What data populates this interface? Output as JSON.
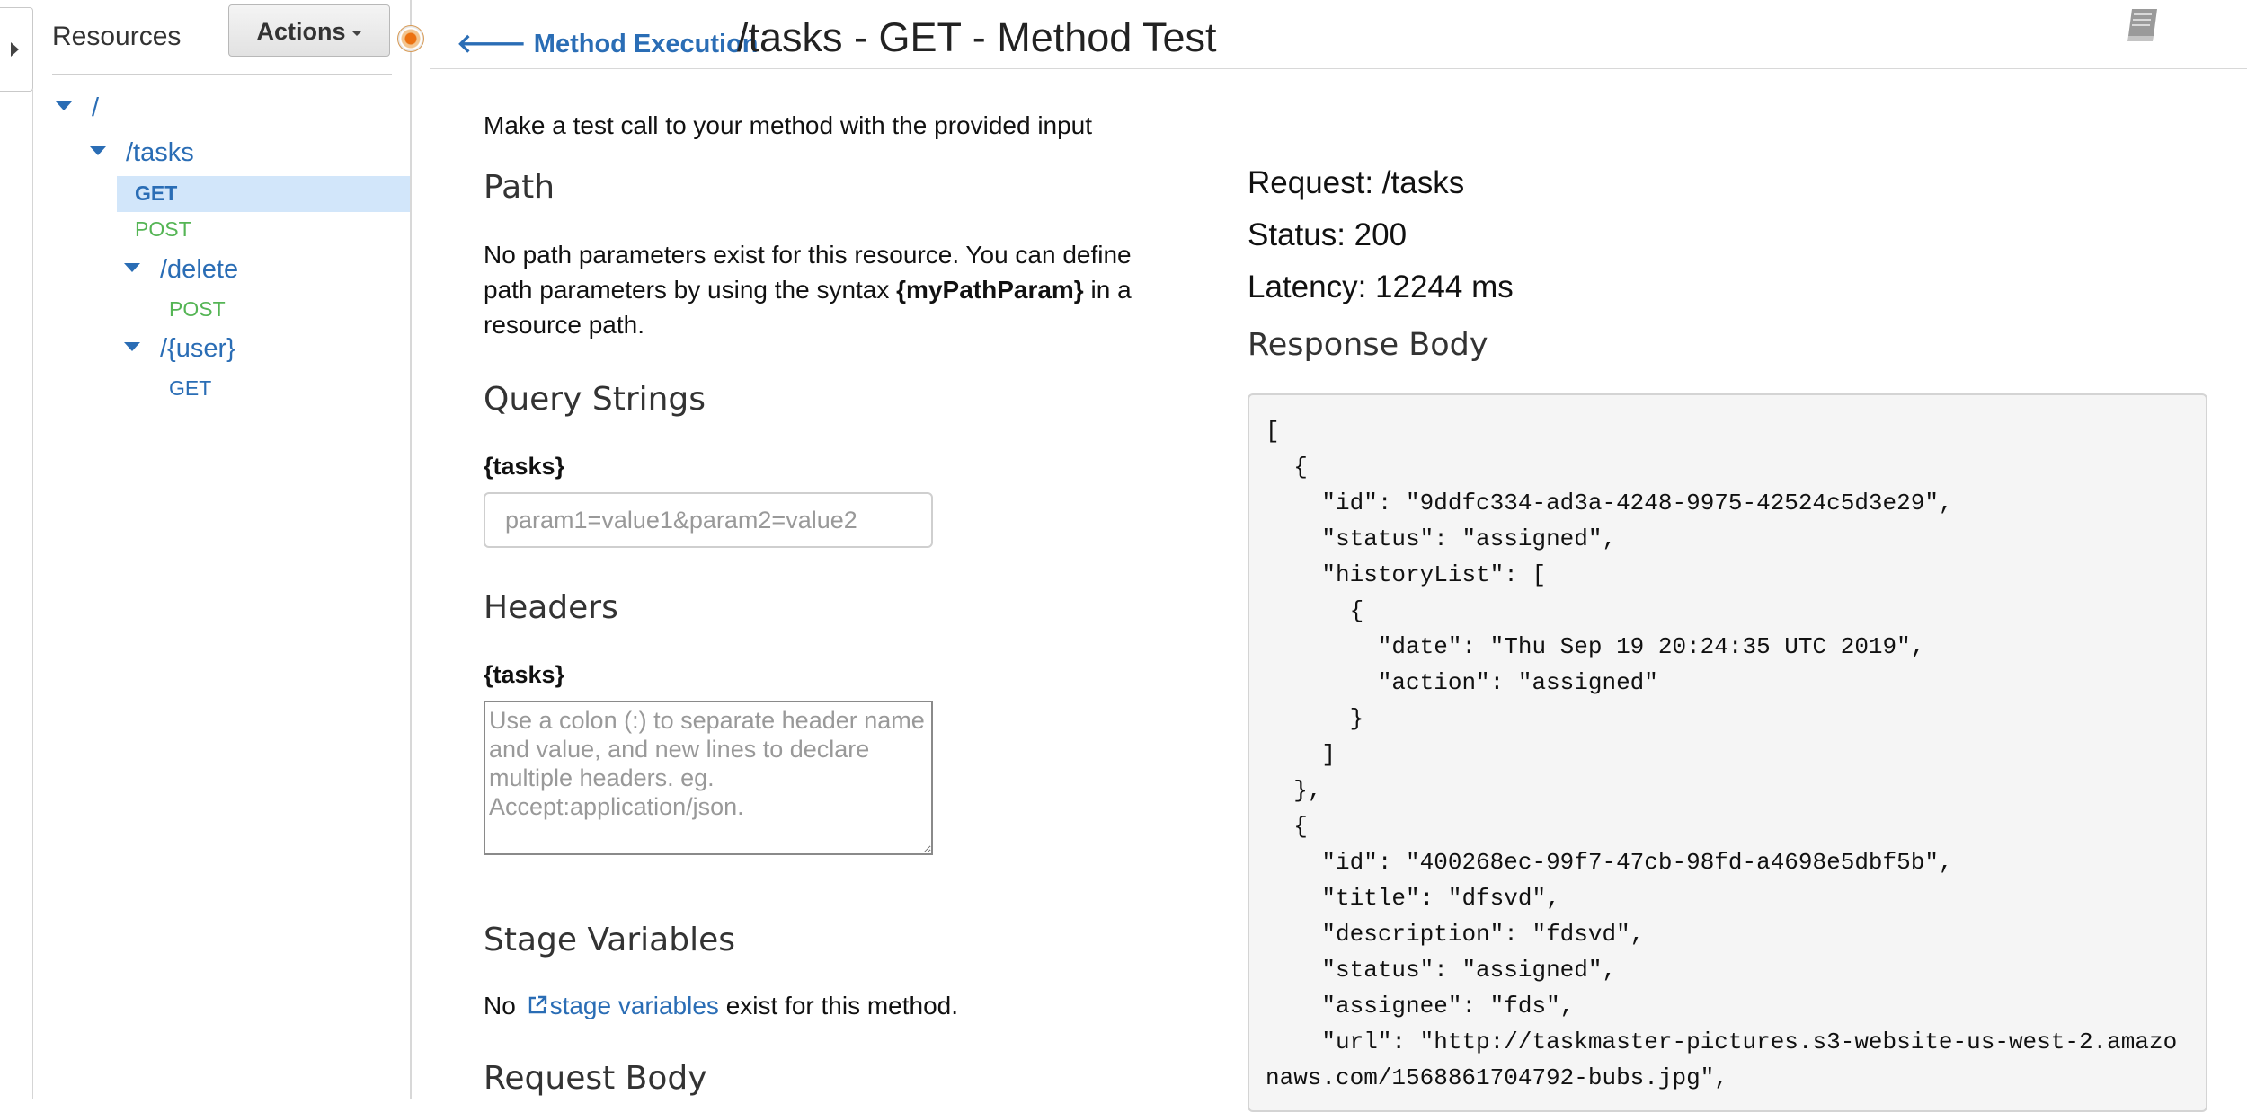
{
  "sidebar": {
    "title": "Resources",
    "actions_label": "Actions",
    "tree": {
      "root": "/",
      "tasks": "/tasks",
      "tasks_get": "GET",
      "tasks_post": "POST",
      "delete": "/delete",
      "delete_post": "POST",
      "user": "/{user}",
      "user_get": "GET"
    }
  },
  "header": {
    "back_label": "Method Execution",
    "title": "/tasks - GET - Method Test"
  },
  "main": {
    "intro": "Make a test call to your method with the provided input",
    "path_heading": "Path",
    "path_text_1": "No path parameters exist for this resource. You can define path parameters by using the syntax ",
    "path_text_bold": "{myPathParam}",
    "path_text_2": " in a resource path.",
    "query_heading": "Query Strings",
    "query_label": "{tasks}",
    "query_placeholder": "param1=value1&param2=value2",
    "headers_heading": "Headers",
    "headers_label": "{tasks}",
    "headers_placeholder": "Use a colon (:) to separate header name and value, and new lines to declare multiple headers. eg. Accept:application/json.",
    "stage_heading": "Stage Variables",
    "stage_pre": "No ",
    "stage_link": "stage variables",
    "stage_post": " exist for this method.",
    "request_body_heading": "Request Body"
  },
  "response": {
    "request": "Request: /tasks",
    "status": "Status: 200",
    "latency": "Latency: 12244 ms",
    "body_heading": "Response Body",
    "body": "[\n  {\n    \"id\": \"9ddfc334-ad3a-4248-9975-42524c5d3e29\",\n    \"status\": \"assigned\",\n    \"historyList\": [\n      {\n        \"date\": \"Thu Sep 19 20:24:35 UTC 2019\",\n        \"action\": \"assigned\"\n      }\n    ]\n  },\n  {\n    \"id\": \"400268ec-99f7-47cb-98fd-a4698e5dbf5b\",\n    \"title\": \"dfsvd\",\n    \"description\": \"fdsvd\",\n    \"status\": \"assigned\",\n    \"assignee\": \"fds\",\n    \"url\": \"http://taskmaster-pictures.s3-website-us-west-2.amazonaws.com/1568861704792-bubs.jpg\","
  },
  "colors": {
    "link": "#2a6db5",
    "post": "#55b555",
    "selected": "#d2e6fa",
    "accent": "#ec7211"
  }
}
